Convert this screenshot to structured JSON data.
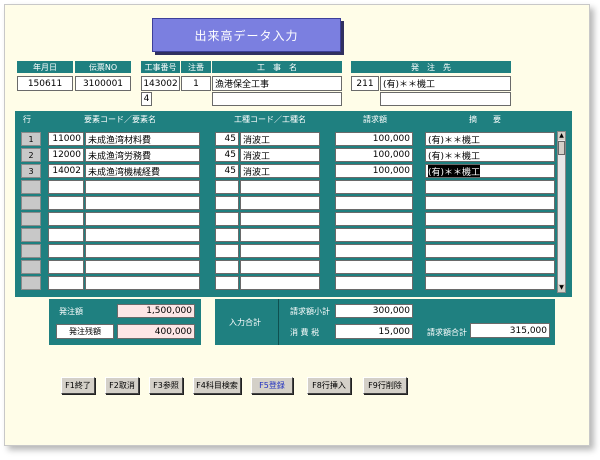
{
  "title": "出来高データ入力",
  "header": {
    "date_label": "年月日",
    "voucher_label": "伝票NO",
    "date_value": "150611",
    "voucher_value": "3100001",
    "job_no_label": "工事番号",
    "note_label": "注番",
    "job_name_label": "工　事　名",
    "job_no_value": "143002",
    "note_value": "1",
    "job_name_value": "漁港保全工事",
    "sub_value": "4",
    "vendor_label": "発　注　先",
    "vendor_code": "211",
    "vendor_name": "(有)＊＊機工"
  },
  "table": {
    "col_row": "行",
    "col_element": "要素コード／要素名",
    "col_worktype": "工種コード／工種名",
    "col_amount": "請求額",
    "col_summary": "摘　　要",
    "rows": [
      {
        "num": "1",
        "code": "11000",
        "name": "未成渔湾材料費",
        "wcode": "45",
        "wname": "消波工",
        "amount": "100,000",
        "summary": "(有)＊＊機工"
      },
      {
        "num": "2",
        "code": "12000",
        "name": "未成渔湾労務費",
        "wcode": "45",
        "wname": "消波工",
        "amount": "100,000",
        "summary": "(有)＊＊機工"
      },
      {
        "num": "3",
        "code": "14002",
        "name": "未成渔湾機械経費",
        "wcode": "45",
        "wname": "消波工",
        "amount": "100,000",
        "summary": "(有)＊＊機工"
      }
    ]
  },
  "summary": {
    "order_amount_label": "発注額",
    "order_amount_value": "1,500,000",
    "order_balance_label": "発注残額",
    "order_balance_value": "400,000",
    "input_total_label": "入力合計",
    "subtotal_label": "請求額小計",
    "subtotal_value": "300,000",
    "tax_label": "消 費 税",
    "tax_value": "15,000",
    "total_label": "請求額合計",
    "total_value": "315,000"
  },
  "buttons": [
    "F1終了",
    "F2取消",
    "F3参照",
    "F4科目検索",
    "F5登録",
    "F8行挿入",
    "F9行削除"
  ]
}
